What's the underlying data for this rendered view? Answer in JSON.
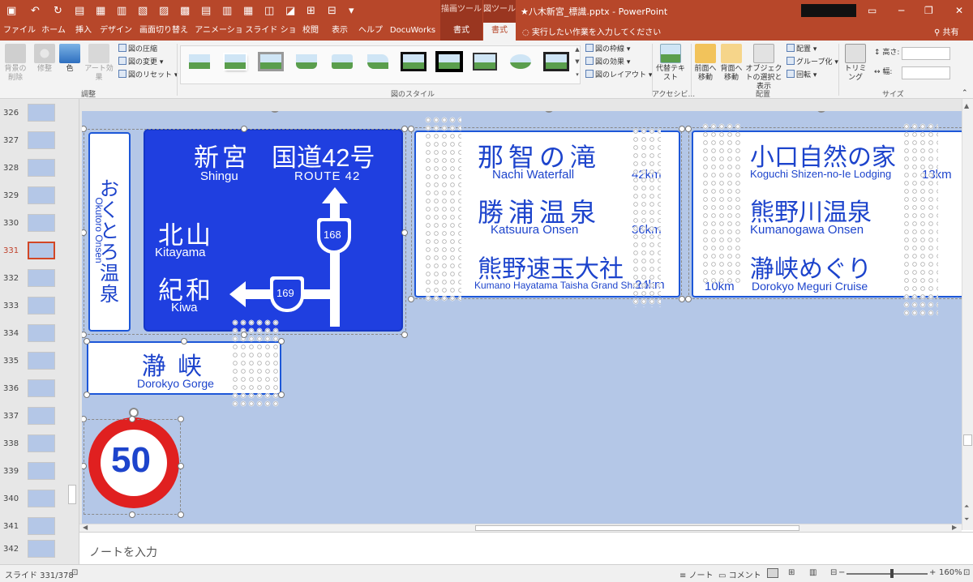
{
  "titlebar": {
    "draw_tools": "描画ツール",
    "picture_tools": "図ツール",
    "document_title": "★八木新宮_標識.pptx  -  PowerPoint"
  },
  "tabs": [
    {
      "label": "ファイル"
    },
    {
      "label": "ホーム"
    },
    {
      "label": "挿入"
    },
    {
      "label": "デザイン"
    },
    {
      "label": "画面切り替え"
    },
    {
      "label": "アニメーション"
    },
    {
      "label": "スライド ショー"
    },
    {
      "label": "校閲"
    },
    {
      "label": "表示"
    },
    {
      "label": "ヘルプ"
    },
    {
      "label": "DocuWorks"
    },
    {
      "label": "書式"
    },
    {
      "label": "書式"
    }
  ],
  "tell_me": "実行したい作業を入力してください",
  "share": "共有",
  "ribbon": {
    "adjust": {
      "remove_bg": "背景の削除",
      "corrections": "修整",
      "color": "色",
      "artistic": "アート効果",
      "compress": "図の圧縮",
      "change": "図の変更",
      "reset": "図のリセット",
      "label": "調整"
    },
    "styles": {
      "border": "図の枠線",
      "effects": "図の効果",
      "layout": "図のレイアウト",
      "label": "図のスタイル"
    },
    "accessibility": {
      "alt_text": "代替テキスト",
      "label": "アクセシビ..."
    },
    "arrange": {
      "bring_forward": "前面へ移動",
      "send_backward": "背面へ移動",
      "selection_pane": "オブジェクトの選択と表示",
      "align": "配置",
      "group": "グループ化",
      "rotate": "回転",
      "label": "配置"
    },
    "size": {
      "crop": "トリミング",
      "height_label": "高さ:",
      "width_label": "幅:",
      "label": "サイズ"
    }
  },
  "slides": [
    {
      "num": "326"
    },
    {
      "num": "327"
    },
    {
      "num": "328"
    },
    {
      "num": "329"
    },
    {
      "num": "330"
    },
    {
      "num": "331"
    },
    {
      "num": "332"
    },
    {
      "num": "333"
    },
    {
      "num": "334"
    },
    {
      "num": "335"
    },
    {
      "num": "336"
    },
    {
      "num": "337"
    },
    {
      "num": "338"
    },
    {
      "num": "339"
    },
    {
      "num": "340"
    },
    {
      "num": "341"
    },
    {
      "num": "342"
    }
  ],
  "signs": {
    "left_vertical": {
      "jp": "おくとろ温泉",
      "en": "Okutoro Onsen"
    },
    "guide": {
      "shingu_jp": "新宮",
      "shingu_en": "Shingu",
      "route_jp": "国道42号",
      "route_en": "ROUTE 42",
      "kitayama_jp": "北山",
      "kitayama_en": "Kitayama",
      "kiwa_jp": "紀和",
      "kiwa_en": "Kiwa",
      "r168": "168",
      "r169": "169"
    },
    "dorokyo": {
      "jp": "瀞峡",
      "en": "Dorokyo Gorge"
    },
    "mid": [
      {
        "jp": "那智の滝",
        "en": "Nachi Waterfall",
        "dist": "42km"
      },
      {
        "jp": "勝浦温泉",
        "en": "Katsuura Onsen",
        "dist": "36km"
      },
      {
        "jp": "熊野速玉大社",
        "en": "Kumano Hayatama Taisha Grand Shrine",
        "dist": "24km"
      }
    ],
    "right": [
      {
        "jp": "小口自然の家",
        "en": "Koguchi Shizen-no-Ie Lodging",
        "dist": "13km"
      },
      {
        "jp": "熊野川温泉",
        "en": "Kumanogawa Onsen",
        "dist": ""
      },
      {
        "jp": "瀞峡めぐり",
        "en": "Dorokyo Meguri Cruise",
        "dist": "10km"
      }
    ],
    "speed_limit": "50"
  },
  "notes_placeholder": "ノートを入力",
  "status": {
    "slide": "スライド 331/378",
    "notes": "ノート",
    "comments": "コメント",
    "zoom": "160%"
  },
  "colors": {
    "accent": "#b7472a",
    "sign_blue": "#1f3fe0",
    "slide_bg": "#b4c7e7",
    "speed_red": "#e02020"
  }
}
